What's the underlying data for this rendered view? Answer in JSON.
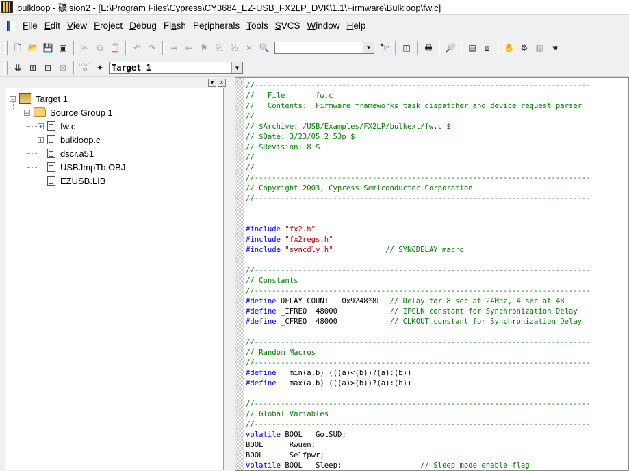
{
  "window": {
    "title": "bulkloop  - 礦ision2 - [E:\\Program Files\\Cypress\\CY3684_EZ-USB_FX2LP_DVK\\1.1\\Firmware\\Bulkloop\\fw.c]"
  },
  "menu": {
    "items": [
      {
        "pre": "",
        "u": "F",
        "post": "ile"
      },
      {
        "pre": "",
        "u": "E",
        "post": "dit"
      },
      {
        "pre": "",
        "u": "V",
        "post": "iew"
      },
      {
        "pre": "",
        "u": "P",
        "post": "roject"
      },
      {
        "pre": "",
        "u": "D",
        "post": "ebug"
      },
      {
        "pre": "Fl",
        "u": "a",
        "post": "sh"
      },
      {
        "pre": "Pe",
        "u": "r",
        "post": "ipherals"
      },
      {
        "pre": "",
        "u": "T",
        "post": "ools"
      },
      {
        "pre": "",
        "u": "S",
        "post": "VCS"
      },
      {
        "pre": "",
        "u": "W",
        "post": "indow"
      },
      {
        "pre": "",
        "u": "H",
        "post": "elp"
      }
    ]
  },
  "toolbar": {
    "icons": [
      "new-file-icon",
      "open-folder-icon",
      "save-icon",
      "save-all-icon",
      "cut-icon",
      "copy-icon",
      "paste-icon",
      "undo-icon",
      "redo-icon",
      "indent-icon",
      "outdent-icon",
      "toggle-bookmark-icon",
      "next-bookmark-icon",
      "prev-bookmark-icon",
      "clear-bookmarks-icon",
      "find-in-files-icon"
    ],
    "find_value": "",
    "icons2": [
      "find-icon",
      "debug-view-icon",
      "print-icon",
      "zoom-icon",
      "window-icon",
      "browse-icon",
      "hand-icon",
      "source-browser-icon",
      "stop-icon",
      "hand2-icon"
    ]
  },
  "build_toolbar": {
    "icons": [
      "translate-icon",
      "build-icon",
      "rebuild-icon",
      "stop-build-icon",
      "download-icon",
      "options-icon"
    ],
    "load_label": "LOAD",
    "target_value": "Target 1"
  },
  "project_tree": {
    "target": "Target 1",
    "group": "Source Group 1",
    "files": [
      "fw.c",
      "bulkloop.c",
      "dscr.a51",
      "USBJmpTb.OBJ",
      "EZUSB.LIB"
    ],
    "expandable": [
      true,
      true,
      false,
      false,
      false
    ]
  },
  "editor": {
    "lines": [
      [
        [
          "c",
          "//-----------------------------------------------------------------------------"
        ]
      ],
      [
        [
          "c",
          "//   File:      fw.c"
        ]
      ],
      [
        [
          "c",
          "//   Contents:  Firmware frameworks task dispatcher and device request parser"
        ]
      ],
      [
        [
          "c",
          "//"
        ]
      ],
      [
        [
          "c",
          "// $Archive: /USB/Examples/FX2LP/bulkext/fw.c $"
        ]
      ],
      [
        [
          "c",
          "// $Date: 3/23/05 2:53p $"
        ]
      ],
      [
        [
          "c",
          "// $Revision: 8 $"
        ]
      ],
      [
        [
          "c",
          "//"
        ]
      ],
      [
        [
          "c",
          "//"
        ]
      ],
      [
        [
          "c",
          "//-----------------------------------------------------------------------------"
        ]
      ],
      [
        [
          "c",
          "// Copyright 2003, Cypress Semiconductor Corporation"
        ]
      ],
      [
        [
          "c",
          "//-----------------------------------------------------------------------------"
        ]
      ],
      [
        [
          "p",
          ""
        ]
      ],
      [
        [
          "p",
          ""
        ]
      ],
      [
        [
          "k",
          "#include "
        ],
        [
          "s",
          "\"fx2.h\""
        ]
      ],
      [
        [
          "k",
          "#include "
        ],
        [
          "s",
          "\"fx2regs.h\""
        ]
      ],
      [
        [
          "k",
          "#include "
        ],
        [
          "s",
          "\"syncdly.h\""
        ],
        [
          "p",
          "            "
        ],
        [
          "c",
          "// SYNCDELAY macro"
        ]
      ],
      [
        [
          "p",
          ""
        ]
      ],
      [
        [
          "c",
          "//-----------------------------------------------------------------------------"
        ]
      ],
      [
        [
          "c",
          "// Constants"
        ]
      ],
      [
        [
          "c",
          "//-----------------------------------------------------------------------------"
        ]
      ],
      [
        [
          "k",
          "#define "
        ],
        [
          "p",
          "DELAY_COUNT   0x9248*8L  "
        ],
        [
          "c",
          "// Delay for 8 sec at 24Mhz, 4 sec at 48"
        ]
      ],
      [
        [
          "k",
          "#define "
        ],
        [
          "p",
          "_IFREQ  48000            "
        ],
        [
          "c",
          "// IFCLK constant for Synchronization Delay"
        ]
      ],
      [
        [
          "k",
          "#define "
        ],
        [
          "p",
          "_CFREQ  48000            "
        ],
        [
          "c",
          "// CLKOUT constant for Synchronization Delay"
        ]
      ],
      [
        [
          "p",
          ""
        ]
      ],
      [
        [
          "c",
          "//-----------------------------------------------------------------------------"
        ]
      ],
      [
        [
          "c",
          "// Random Macros"
        ]
      ],
      [
        [
          "c",
          "//-----------------------------------------------------------------------------"
        ]
      ],
      [
        [
          "k",
          "#define "
        ],
        [
          "p",
          "  min(a,b) (((a)<(b))?(a):(b))"
        ]
      ],
      [
        [
          "k",
          "#define "
        ],
        [
          "p",
          "  max(a,b) (((a)>(b))?(a):(b))"
        ]
      ],
      [
        [
          "p",
          ""
        ]
      ],
      [
        [
          "c",
          "//-----------------------------------------------------------------------------"
        ]
      ],
      [
        [
          "c",
          "// Global Variables"
        ]
      ],
      [
        [
          "c",
          "//-----------------------------------------------------------------------------"
        ]
      ],
      [
        [
          "k",
          "volatile "
        ],
        [
          "p",
          "BOOL   GotSUD;"
        ]
      ],
      [
        [
          "p",
          "BOOL      Rwuen;"
        ]
      ],
      [
        [
          "p",
          "BOOL      Selfpwr;"
        ]
      ],
      [
        [
          "k",
          "volatile "
        ],
        [
          "p",
          "BOOL   Sleep;                  "
        ],
        [
          "c",
          "// Sleep mode enable flag"
        ]
      ]
    ]
  }
}
